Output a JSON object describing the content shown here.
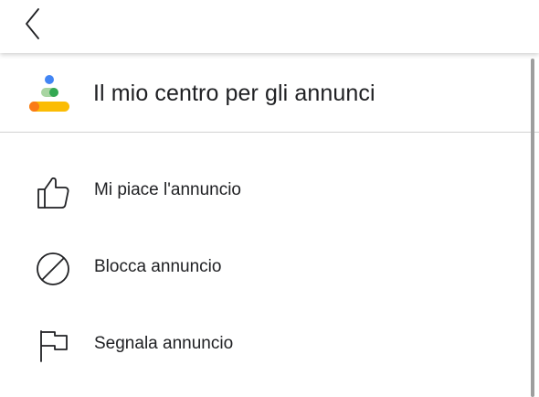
{
  "topbar": {
    "back_icon": "back-chevron-icon"
  },
  "header": {
    "title": "Il mio centro per gli annunci",
    "logo_icon": "my-ad-center-logo-icon"
  },
  "menu": {
    "items": [
      {
        "label": "Mi piace l'annuncio",
        "icon": "thumbs-up-icon"
      },
      {
        "label": "Blocca annuncio",
        "icon": "block-icon"
      },
      {
        "label": "Segnala annuncio",
        "icon": "flag-icon"
      }
    ]
  },
  "colors": {
    "logo_blue": "#4285F4",
    "logo_green": "#34A853",
    "logo_yellow": "#FBBC04",
    "logo_orange": "#FA7B17",
    "text": "#202124",
    "divider": "#d2d2d2",
    "scrollbar": "#9e9e9e"
  }
}
